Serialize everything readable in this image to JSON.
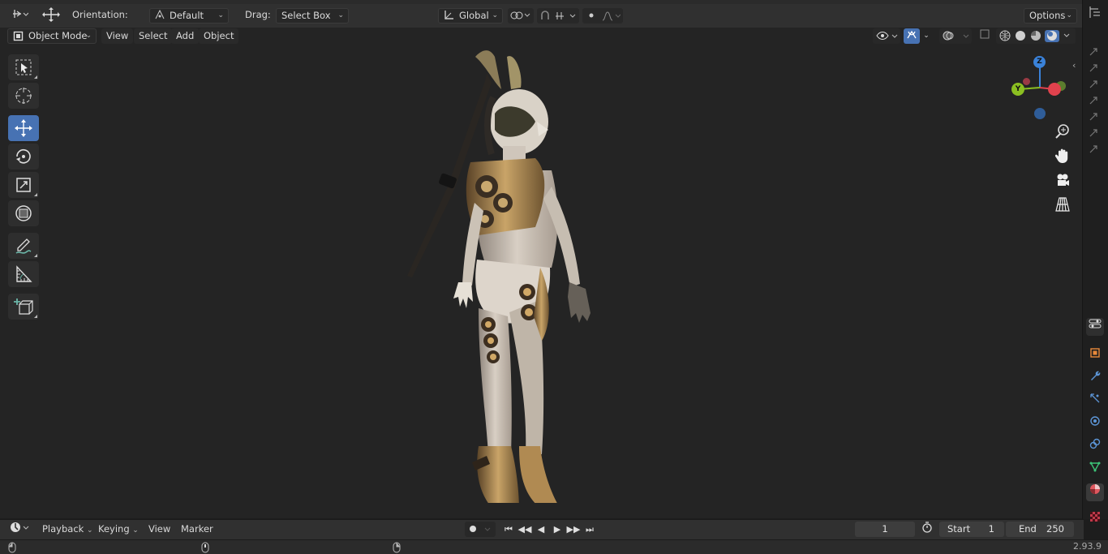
{
  "header": {
    "orientation_label": "Orientation:",
    "orientation_value": "Default",
    "drag_label": "Drag:",
    "drag_value": "Select Box",
    "transform_orientation": "Global",
    "options_label": "Options"
  },
  "viewport_header": {
    "mode": "Object Mode",
    "menus": [
      "View",
      "Select",
      "Add",
      "Object"
    ]
  },
  "toolbar": {
    "tools": [
      "select-box",
      "cursor",
      "move",
      "rotate",
      "scale",
      "transform",
      "annotate",
      "measure",
      "add-cube"
    ],
    "active": "move"
  },
  "gizmo": {
    "z": "Z",
    "y": "Y",
    "x": "X"
  },
  "timeline": {
    "menus": [
      "Playback",
      "Keying",
      "View",
      "Marker"
    ],
    "current_frame": "1",
    "start_label": "Start",
    "start_value": "1",
    "end_label": "End",
    "end_value": "250"
  },
  "status": {
    "version": "2.93.9"
  },
  "colors": {
    "accent": "#4772b3",
    "x_axis": "#e0424d",
    "y_axis": "#8bbf21",
    "z_axis": "#3a82d9"
  }
}
